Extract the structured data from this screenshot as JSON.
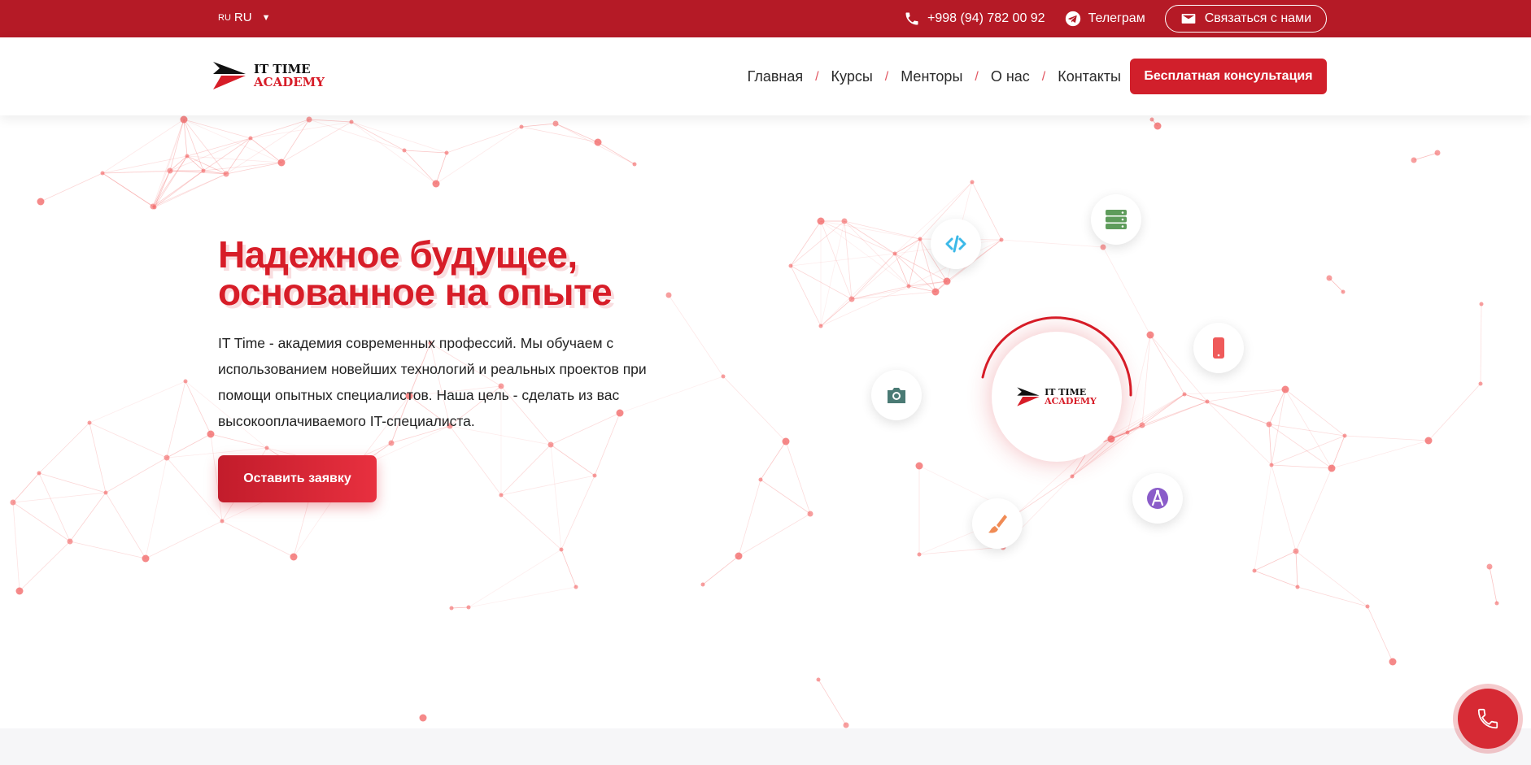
{
  "topbar": {
    "lang_code": "RU",
    "lang_label": "RU",
    "phone": "+998 (94) 782 00 92",
    "telegram": "Телеграм",
    "contact": "Связаться с нами"
  },
  "header": {
    "logo_line1": "IT TIME",
    "logo_line2": "ACADEMY",
    "nav": [
      "Главная",
      "Курсы",
      "Менторы",
      "О нас",
      "Контакты"
    ],
    "cta": "Бесплатная консультация"
  },
  "hero": {
    "title_line1": "Надежное будущее,",
    "title_line2": "основанное на опыте",
    "description": "IT Time - академия современных профессий. Мы обучаем с использованием новейших технологий и реальных проектов при помощи опытных специалистов. Наша цель - сделать из вас высокооплачиваемого IT-специалиста.",
    "button": "Оставить заявку"
  },
  "orbit": {
    "center_line1": "IT TIME",
    "center_line2": "ACADEMY",
    "icons": [
      "code-icon",
      "server-icon",
      "smartphone-icon",
      "camera-icon",
      "brush-icon",
      "design-compass-icon"
    ]
  },
  "colors": {
    "brand_red": "#d71d28",
    "topbar_red": "#b51a26",
    "network": "#f26b6b"
  }
}
